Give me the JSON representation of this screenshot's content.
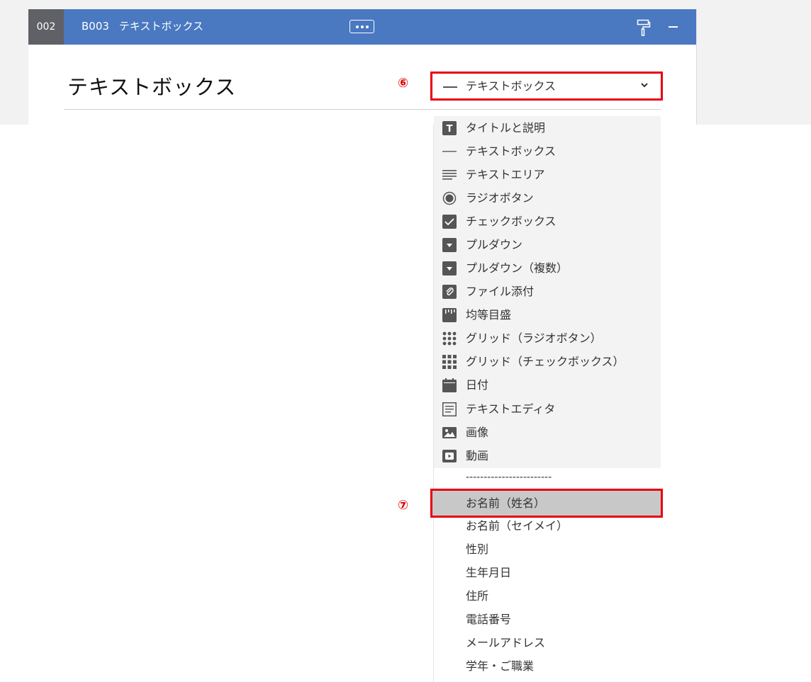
{
  "header": {
    "number": "002",
    "code": "B003",
    "name": "テキストボックス",
    "more_label": "•••"
  },
  "question": {
    "title": "テキストボックス"
  },
  "callouts": {
    "six": "⑥",
    "seven": "⑦"
  },
  "type_select": {
    "value": "テキストボックス",
    "icon": "line-icon"
  },
  "menu": {
    "types": [
      {
        "label": "タイトルと説明",
        "icon": "title-icon"
      },
      {
        "label": "テキストボックス",
        "icon": "line-icon"
      },
      {
        "label": "テキストエリア",
        "icon": "lines-icon"
      },
      {
        "label": "ラジオボタン",
        "icon": "radio-icon"
      },
      {
        "label": "チェックボックス",
        "icon": "checkbox-icon"
      },
      {
        "label": "プルダウン",
        "icon": "dropdown-icon"
      },
      {
        "label": "プルダウン（複数）",
        "icon": "dropdown-icon"
      },
      {
        "label": "ファイル添付",
        "icon": "paperclip-icon"
      },
      {
        "label": "均等目盛",
        "icon": "ruler-icon"
      },
      {
        "label": "グリッド（ラジオボタン）",
        "icon": "dot-grid-icon"
      },
      {
        "label": "グリッド（チェックボックス）",
        "icon": "square-grid-icon"
      },
      {
        "label": "日付",
        "icon": "calendar-icon"
      },
      {
        "label": "テキストエディタ",
        "icon": "editor-icon"
      },
      {
        "label": "画像",
        "icon": "image-icon"
      },
      {
        "label": "動画",
        "icon": "video-icon"
      }
    ],
    "separator": "------------------------",
    "selected": "お名前（姓名）",
    "presets": [
      "お名前（セイメイ）",
      "性別",
      "生年月日",
      "住所",
      "電話番号",
      "メールアドレス",
      "学年・ご職業"
    ]
  }
}
